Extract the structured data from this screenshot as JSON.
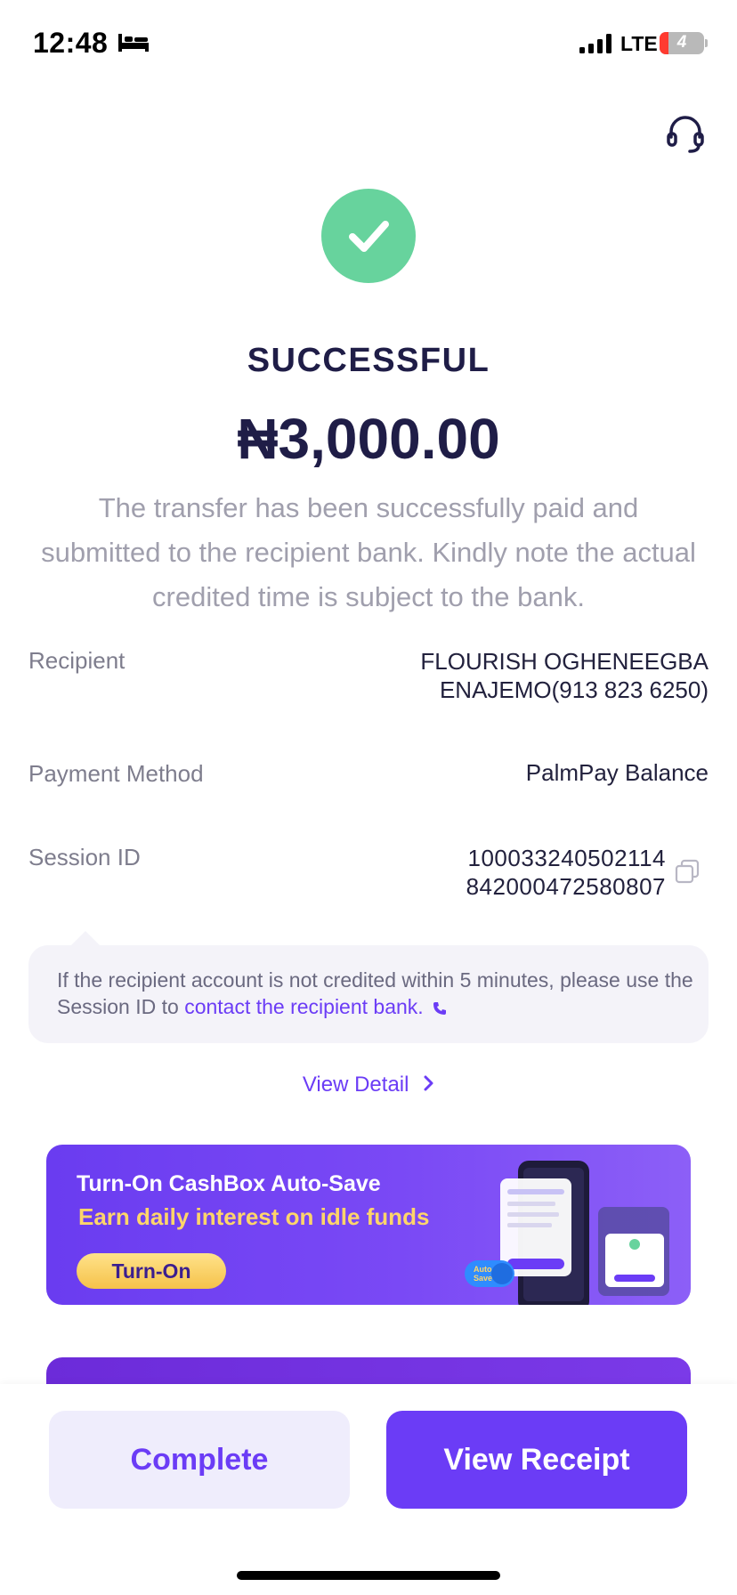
{
  "status_bar": {
    "time": "12:48",
    "network": "LTE",
    "battery": "4",
    "battery_level": 0.2,
    "icons": [
      "bed-icon",
      "signal-icon",
      "battery-icon"
    ]
  },
  "header": {
    "support_icon": "headset-icon"
  },
  "result": {
    "status": "SUCCESSFUL",
    "amount": "₦3,000.00",
    "note": "The transfer has been successfully paid and submitted to the recipient bank. Kindly note the actual credited time is subject to the bank."
  },
  "details": {
    "recipient_label": "Recipient",
    "recipient_value_line1": "FLOURISH OGHENEEGBA",
    "recipient_value_line2": "ENAJEMO(913 823 6250)",
    "payment_method_label": "Payment Method",
    "payment_method_value": "PalmPay Balance",
    "session_id_label": "Session ID",
    "session_id_line1": "100033240502114",
    "session_id_line2": "842000472580807"
  },
  "info": {
    "text": "If the recipient account is not credited within 5 minutes, please use the Session ID to ",
    "link": "contact the recipient bank."
  },
  "view_detail": "View Detail",
  "banner": {
    "title": "Turn-On CashBox Auto-Save",
    "subtitle": "Earn daily interest on idle funds",
    "button": "Turn-On"
  },
  "actions": {
    "complete": "Complete",
    "view_receipt": "View Receipt"
  },
  "colors": {
    "accent": "#6b3cf6",
    "success": "#67d39d",
    "banner_yellow": "#ffd56a"
  }
}
